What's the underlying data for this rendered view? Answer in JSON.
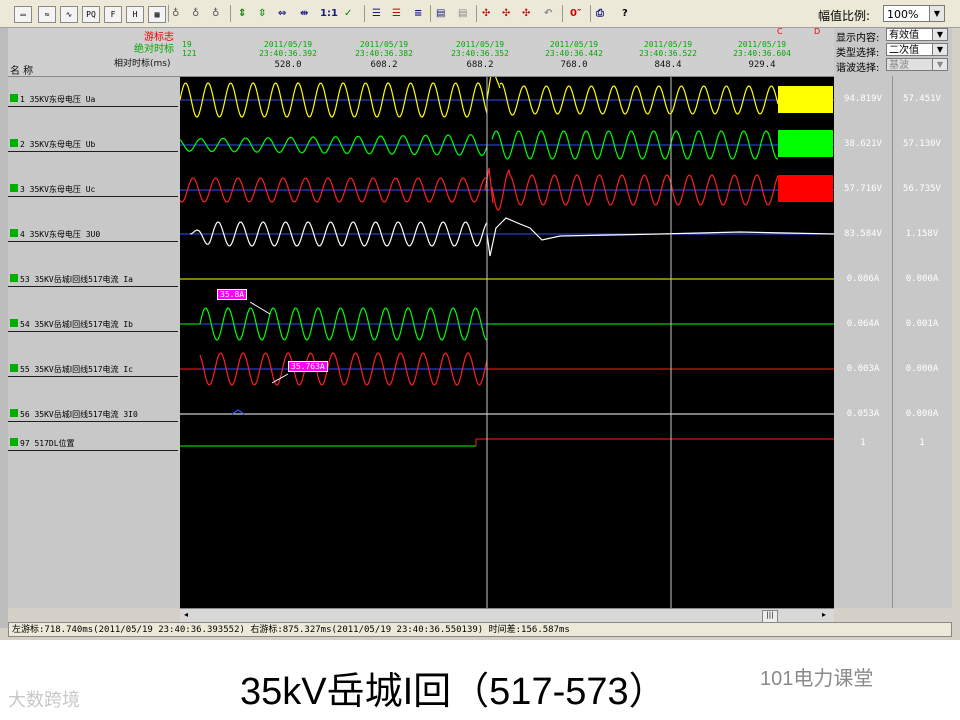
{
  "toolbar": {
    "buttons": [
      "PQ",
      "F",
      "H",
      "1:1",
      "0″",
      "?"
    ],
    "scale_label": "幅值比例:",
    "scale_value": "100%"
  },
  "header": {
    "cursor_label": "游标志",
    "abs_time_label": "绝对时标",
    "rel_time_label": "相对时标(ms)",
    "name_label": "名 称",
    "left_edge_a": "19",
    "left_edge_b": "121",
    "dates": [
      {
        "d": "2011/05/19",
        "t": "23:40:36.392"
      },
      {
        "d": "2011/05/19",
        "t": "23:40:36.382"
      },
      {
        "d": "2011/05/19",
        "t": "23:40:36.352"
      },
      {
        "d": "2011/05/19",
        "t": "23:40:36.442"
      },
      {
        "d": "2011/05/19",
        "t": "23:40:36.522"
      },
      {
        "d": "2011/05/19",
        "t": "23:40:36.604"
      }
    ],
    "ticks": [
      "528.0",
      "608.2",
      "688.2",
      "768.0",
      "848.4",
      "929.4"
    ],
    "cursor_c": "C",
    "cursor_d": "D"
  },
  "right_panel": {
    "display_label": "显示内容:",
    "display_value": "有效值",
    "type_label": "类型选择:",
    "type_value": "二次值",
    "harmonic_label": "谐波选择:",
    "harmonic_value": "基波"
  },
  "channels": [
    {
      "label": "1 35KV东母电压 Ua",
      "v1": "94.819V",
      "v2": "57.451V"
    },
    {
      "label": "2 35KV东母电压 Ub",
      "v1": "38.621V",
      "v2": "57.130V"
    },
    {
      "label": "3 35KV东母电压 Uc",
      "v1": "57.716V",
      "v2": "56.735V"
    },
    {
      "label": "4 35KV东母电压 3U0",
      "v1": "83.584V",
      "v2": "1.158V"
    },
    {
      "label": "53 35KV岳城Ⅰ回线517电流 Ia",
      "v1": "0.086A",
      "v2": "0.000A"
    },
    {
      "label": "54 35KV岳城Ⅰ回线517电流 Ib",
      "v1": "0.064A",
      "v2": "0.001A"
    },
    {
      "label": "55 35KV岳城Ⅰ回线517电流 Ic",
      "v1": "0.003A",
      "v2": "0.000A"
    },
    {
      "label": "56 35KV岳城Ⅰ回线517电流 3I0",
      "v1": "0.053A",
      "v2": "0.000A"
    },
    {
      "label": "97 517DL位置",
      "v1": "1",
      "v2": "1"
    }
  ],
  "markers": [
    "35.8A",
    "35.763A"
  ],
  "status_text": "左游标:718.740ms(2011/05/19 23:40:36.393552) 右游标:875.327ms(2011/05/19 23:40:36.550139) 时间差:156.587ms",
  "caption": "35kV岳城I回（517-573）",
  "watermark_left": "大数跨境",
  "watermark_right": "101电力课堂",
  "colors": {
    "phase_a": "#ffff00",
    "phase_b": "#00ff00",
    "phase_c": "#ff2020",
    "zero_seq": "#ffffff",
    "baseline": "#3050ff"
  }
}
